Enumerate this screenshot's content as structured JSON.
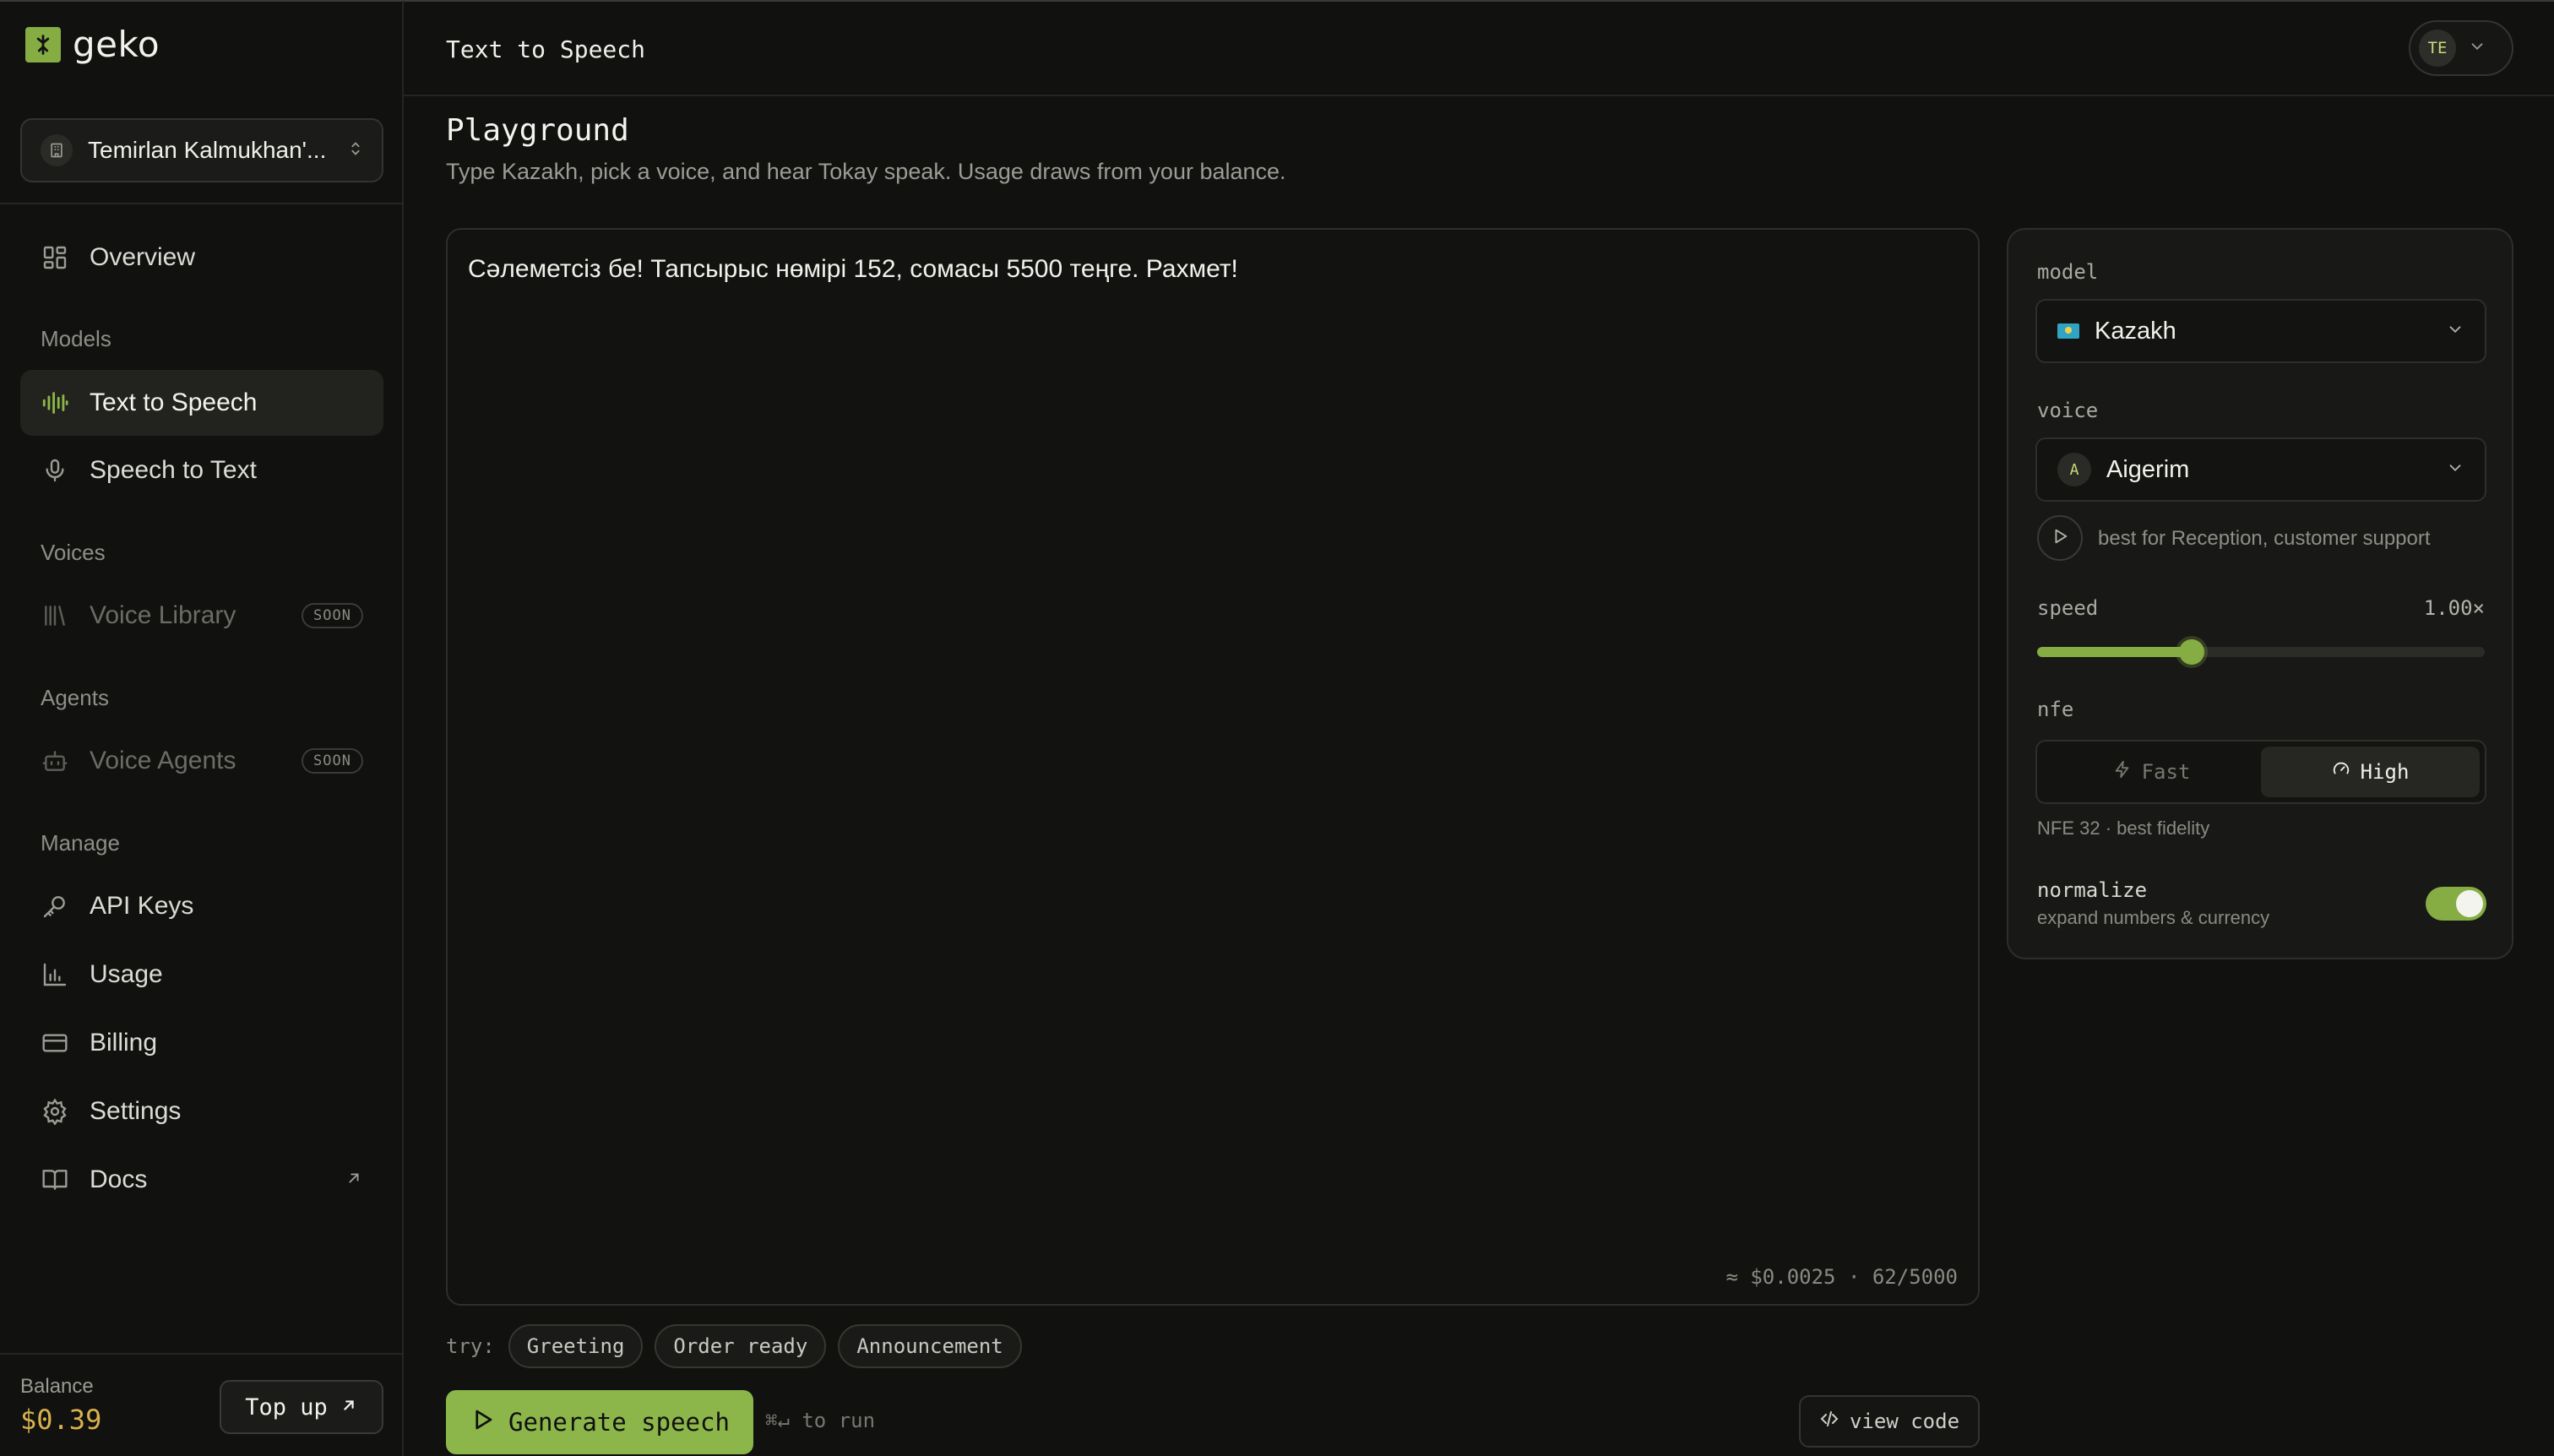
{
  "app": {
    "name": "geko"
  },
  "org": {
    "name": "Temirlan Kalmukhan'..."
  },
  "nav": {
    "overview": "Overview",
    "models_section": "Models",
    "tts": "Text to Speech",
    "stt": "Speech to Text",
    "voices_section": "Voices",
    "voice_library": "Voice Library",
    "agents_section": "Agents",
    "voice_agents": "Voice Agents",
    "manage_section": "Manage",
    "api_keys": "API Keys",
    "usage": "Usage",
    "billing": "Billing",
    "settings": "Settings",
    "docs": "Docs",
    "soon_badge": "SOON"
  },
  "balance": {
    "label": "Balance",
    "value": "$0.39",
    "topup_label": "Top up"
  },
  "header": {
    "title": "Text to Speech",
    "user_initials": "TE"
  },
  "page": {
    "title": "Playground",
    "subtitle": "Type Kazakh, pick a voice, and hear Tokay speak. Usage draws from your balance."
  },
  "editor": {
    "text": "Сәлеметсіз бе! Тапсырыс нөмірі 152, сомасы 5500 теңге. Рахмет!",
    "meta": "≈ $0.0025 · 62/5000"
  },
  "try": {
    "label": "try:",
    "chips": [
      "Greeting",
      "Order ready",
      "Announcement"
    ]
  },
  "actions": {
    "generate_label": "Generate speech",
    "run_hint": "⌘↵ to run",
    "view_code_label": "view code"
  },
  "panel": {
    "model_label": "model",
    "model_value": "Kazakh",
    "voice_label": "voice",
    "voice_value": "Aigerim",
    "voice_initial": "A",
    "voice_desc": "best for Reception, customer support",
    "speed_label": "speed",
    "speed_value": "1.00×",
    "speed_fraction": 0.345,
    "nfe_label": "nfe",
    "nfe_options": [
      "Fast",
      "High"
    ],
    "nfe_selected": "High",
    "nfe_note": "NFE 32 · best fidelity",
    "normalize_label": "normalize",
    "normalize_sub": "expand numbers & currency",
    "normalize_on": true
  },
  "colors": {
    "accent": "#86ad44",
    "balance": "#d9b24d",
    "background": "#111110"
  }
}
